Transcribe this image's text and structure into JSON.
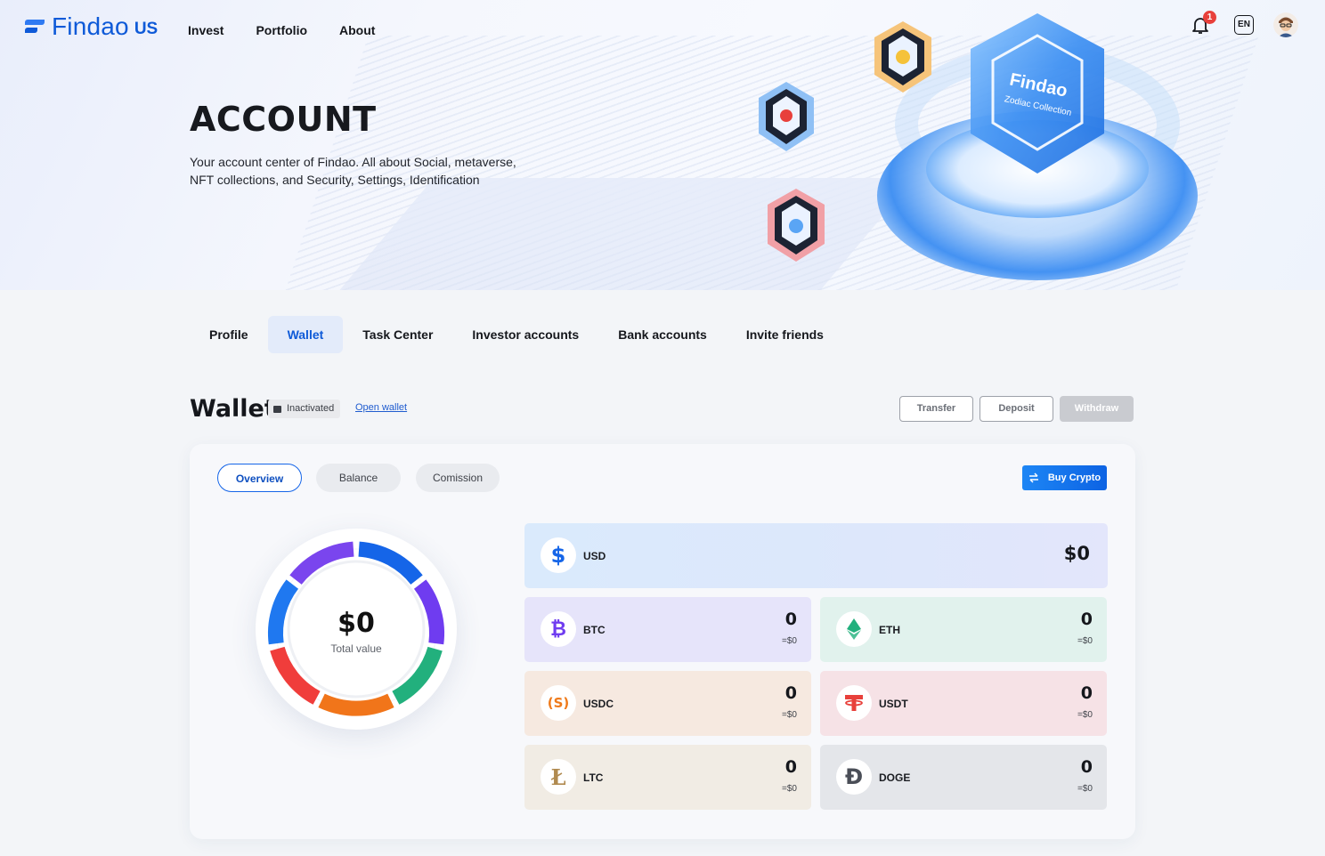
{
  "brand": {
    "name": "Findao",
    "region": "US"
  },
  "nav": {
    "links": [
      "Invest",
      "Portfolio",
      "About"
    ],
    "notifications": "1",
    "language": "EN"
  },
  "hero": {
    "title": "ACCOUNT",
    "description": "Your account center of Findao. All about Social, metaverse, NFT collections, and Security, Settings, Identification",
    "art_text": [
      "Findao",
      "Zodiac Collection"
    ]
  },
  "tabs": [
    "Profile",
    "Wallet",
    "Task Center",
    "Investor accounts",
    "Bank accounts",
    "Invite friends"
  ],
  "active_tab": "Wallet",
  "wallet": {
    "title": "Wallet",
    "status": "Inactivated",
    "open_link": "Open wallet",
    "actions": {
      "transfer": "Transfer",
      "deposit": "Deposit",
      "withdraw": "Withdraw"
    },
    "segments": {
      "overview": "Overview",
      "balance": "Balance",
      "comission": "Comission"
    },
    "active_segment": "Overview",
    "buy_crypto": "Buy Crypto",
    "total": {
      "value": "$0",
      "label": "Total value"
    },
    "usd": {
      "name": "USD",
      "amount": "$0"
    },
    "assets": [
      {
        "name": "BTC",
        "amount": "0",
        "usd": "=$0",
        "bg": "#e6e4fa",
        "color": "#6f3cf0",
        "icon": "bitcoin-icon"
      },
      {
        "name": "ETH",
        "amount": "0",
        "usd": "=$0",
        "bg": "#e1f2ed",
        "color": "#22b07d",
        "icon": "ethereum-icon"
      },
      {
        "name": "USDC",
        "amount": "0",
        "usd": "=$0",
        "bg": "#f6e9e0",
        "color": "#ef7a1a",
        "icon": "usdc-icon"
      },
      {
        "name": "USDT",
        "amount": "0",
        "usd": "=$0",
        "bg": "#f6e2e6",
        "color": "#e8403b",
        "icon": "tether-icon"
      },
      {
        "name": "LTC",
        "amount": "0",
        "usd": "=$0",
        "bg": "#f1ece4",
        "color": "#b08a4f",
        "icon": "litecoin-icon"
      },
      {
        "name": "DOGE",
        "amount": "0",
        "usd": "=$0",
        "bg": "#e4e6ea",
        "color": "#4a4e57",
        "icon": "dogecoin-icon"
      }
    ]
  },
  "colors": {
    "primary": "#0e5ad8",
    "accent": "#1d86f5"
  }
}
